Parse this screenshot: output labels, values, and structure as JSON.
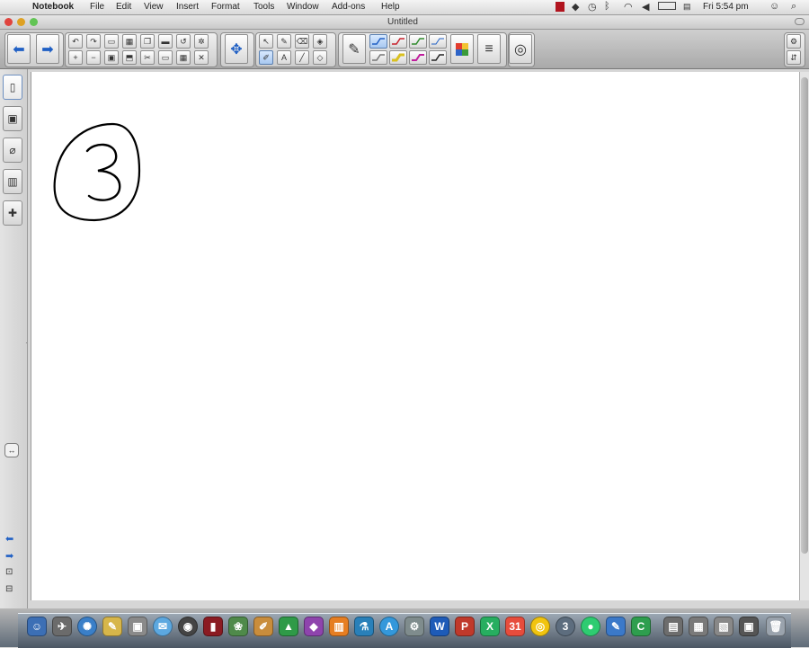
{
  "menubar": {
    "apple": "",
    "app_name": "Notebook",
    "items": [
      "File",
      "Edit",
      "View",
      "Insert",
      "Format",
      "Tools",
      "Window",
      "Add-ons",
      "Help"
    ],
    "clock": "Fri 5:54 pm"
  },
  "window": {
    "title": "Untitled"
  },
  "canvas": {
    "drawing_label": "handwritten-number-3"
  },
  "colors": {
    "pen_blue": "#1f5fc4",
    "pen_red": "#c8202a",
    "pen_green": "#2f8a2c",
    "pen_magenta": "#c01d9c",
    "accent_blue": "#5a7fb0"
  },
  "icons": {
    "toolbar": [
      "back-arrow",
      "forward-arrow",
      "undo",
      "redo",
      "open-file",
      "paste",
      "copy",
      "screen-shade",
      "reset",
      "settings",
      "new-page",
      "delete-page",
      "save",
      "full-screen",
      "cut",
      "table",
      "close",
      "capture",
      "select",
      "magic-pen",
      "eraser",
      "fill",
      "pens",
      "text",
      "line",
      "shape",
      "pen",
      "pen-style",
      "color-palette",
      "line-style",
      "properties",
      "settings-gear",
      "move-toolbar"
    ],
    "sidebar": [
      "page-sorter",
      "gallery",
      "attachments",
      "properties",
      "add-ons",
      "expand",
      "left-arrow",
      "right-arrow",
      "lock",
      "unlock"
    ]
  }
}
